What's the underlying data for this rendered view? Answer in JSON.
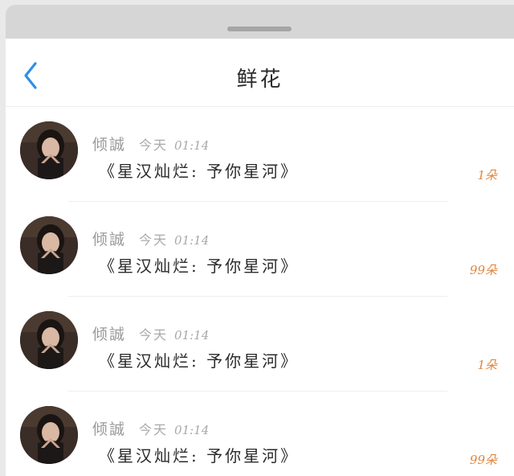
{
  "colors": {
    "accent_blue": "#2f8fe6",
    "flower_count": "#e0863f",
    "username_gray": "#9a9a9a"
  },
  "header": {
    "back_icon": "chevron-left-icon",
    "title": "鲜花"
  },
  "items": [
    {
      "avatar_icon": "user-avatar",
      "name": "倾誠",
      "day": "今天",
      "time": "01:14",
      "message": "《星汉灿烂: 予你星河》",
      "count": "1朵"
    },
    {
      "avatar_icon": "user-avatar",
      "name": "倾誠",
      "day": "今天",
      "time": "01:14",
      "message": "《星汉灿烂: 予你星河》",
      "count": "99朵"
    },
    {
      "avatar_icon": "user-avatar",
      "name": "倾誠",
      "day": "今天",
      "time": "01:14",
      "message": "《星汉灿烂: 予你星河》",
      "count": "1朵"
    },
    {
      "avatar_icon": "user-avatar",
      "name": "倾誠",
      "day": "今天",
      "time": "01:14",
      "message": "《星汉灿烂: 予你星河》",
      "count": "99朵"
    }
  ]
}
